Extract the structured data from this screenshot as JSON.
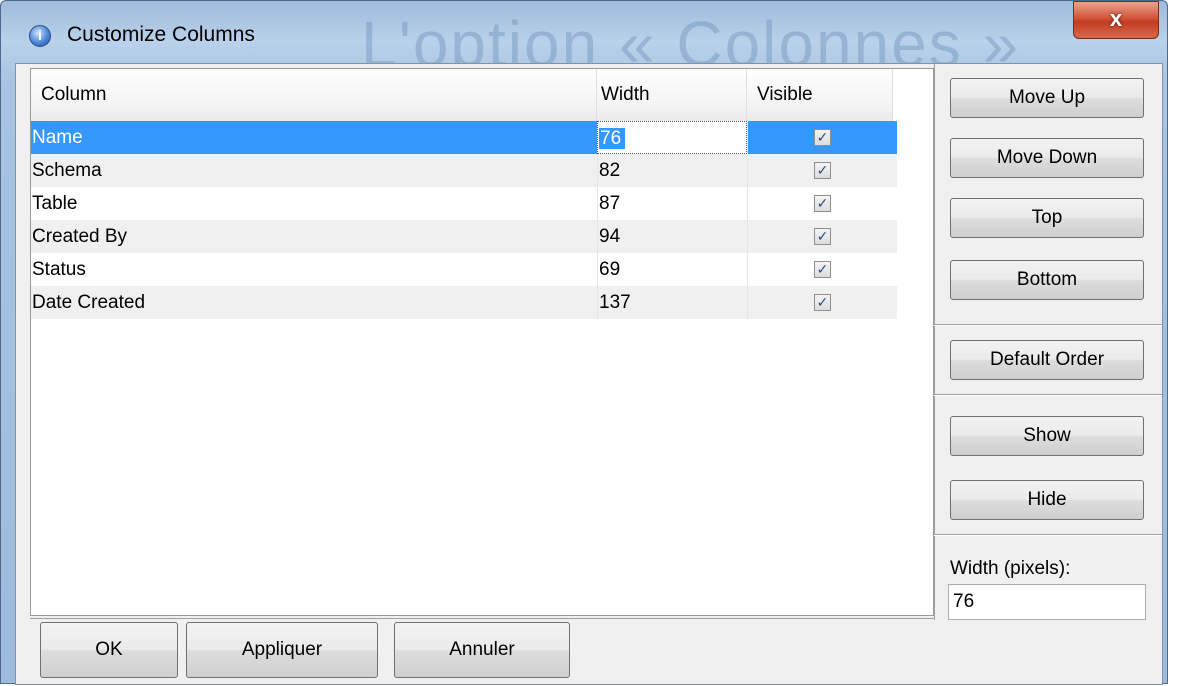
{
  "window": {
    "title": "Customize Columns",
    "background_text": "L'option « Colonnes »",
    "close_label": "x"
  },
  "table": {
    "headers": [
      "Column",
      "Width",
      "Visible"
    ],
    "rows": [
      {
        "column": "Name",
        "width": "76",
        "visible": true,
        "selected": true
      },
      {
        "column": "Schema",
        "width": "82",
        "visible": true,
        "selected": false
      },
      {
        "column": "Table",
        "width": "87",
        "visible": true,
        "selected": false
      },
      {
        "column": "Created By",
        "width": "94",
        "visible": true,
        "selected": false
      },
      {
        "column": "Status",
        "width": "69",
        "visible": true,
        "selected": false
      },
      {
        "column": "Date Created",
        "width": "137",
        "visible": true,
        "selected": false
      }
    ],
    "checkbox_glyph": "✓"
  },
  "side_buttons": {
    "move_up": "Move Up",
    "move_down": "Move Down",
    "top": "Top",
    "bottom": "Bottom",
    "default_order": "Default Order",
    "show": "Show",
    "hide": "Hide"
  },
  "width_field": {
    "label": "Width (pixels):",
    "value": "76"
  },
  "footer_buttons": {
    "ok": "OK",
    "apply": "Appliquer",
    "cancel": "Annuler"
  },
  "colors": {
    "selection": "#3399ff",
    "alt_row": "#f0f0f0",
    "close_button": "#c33c22"
  }
}
